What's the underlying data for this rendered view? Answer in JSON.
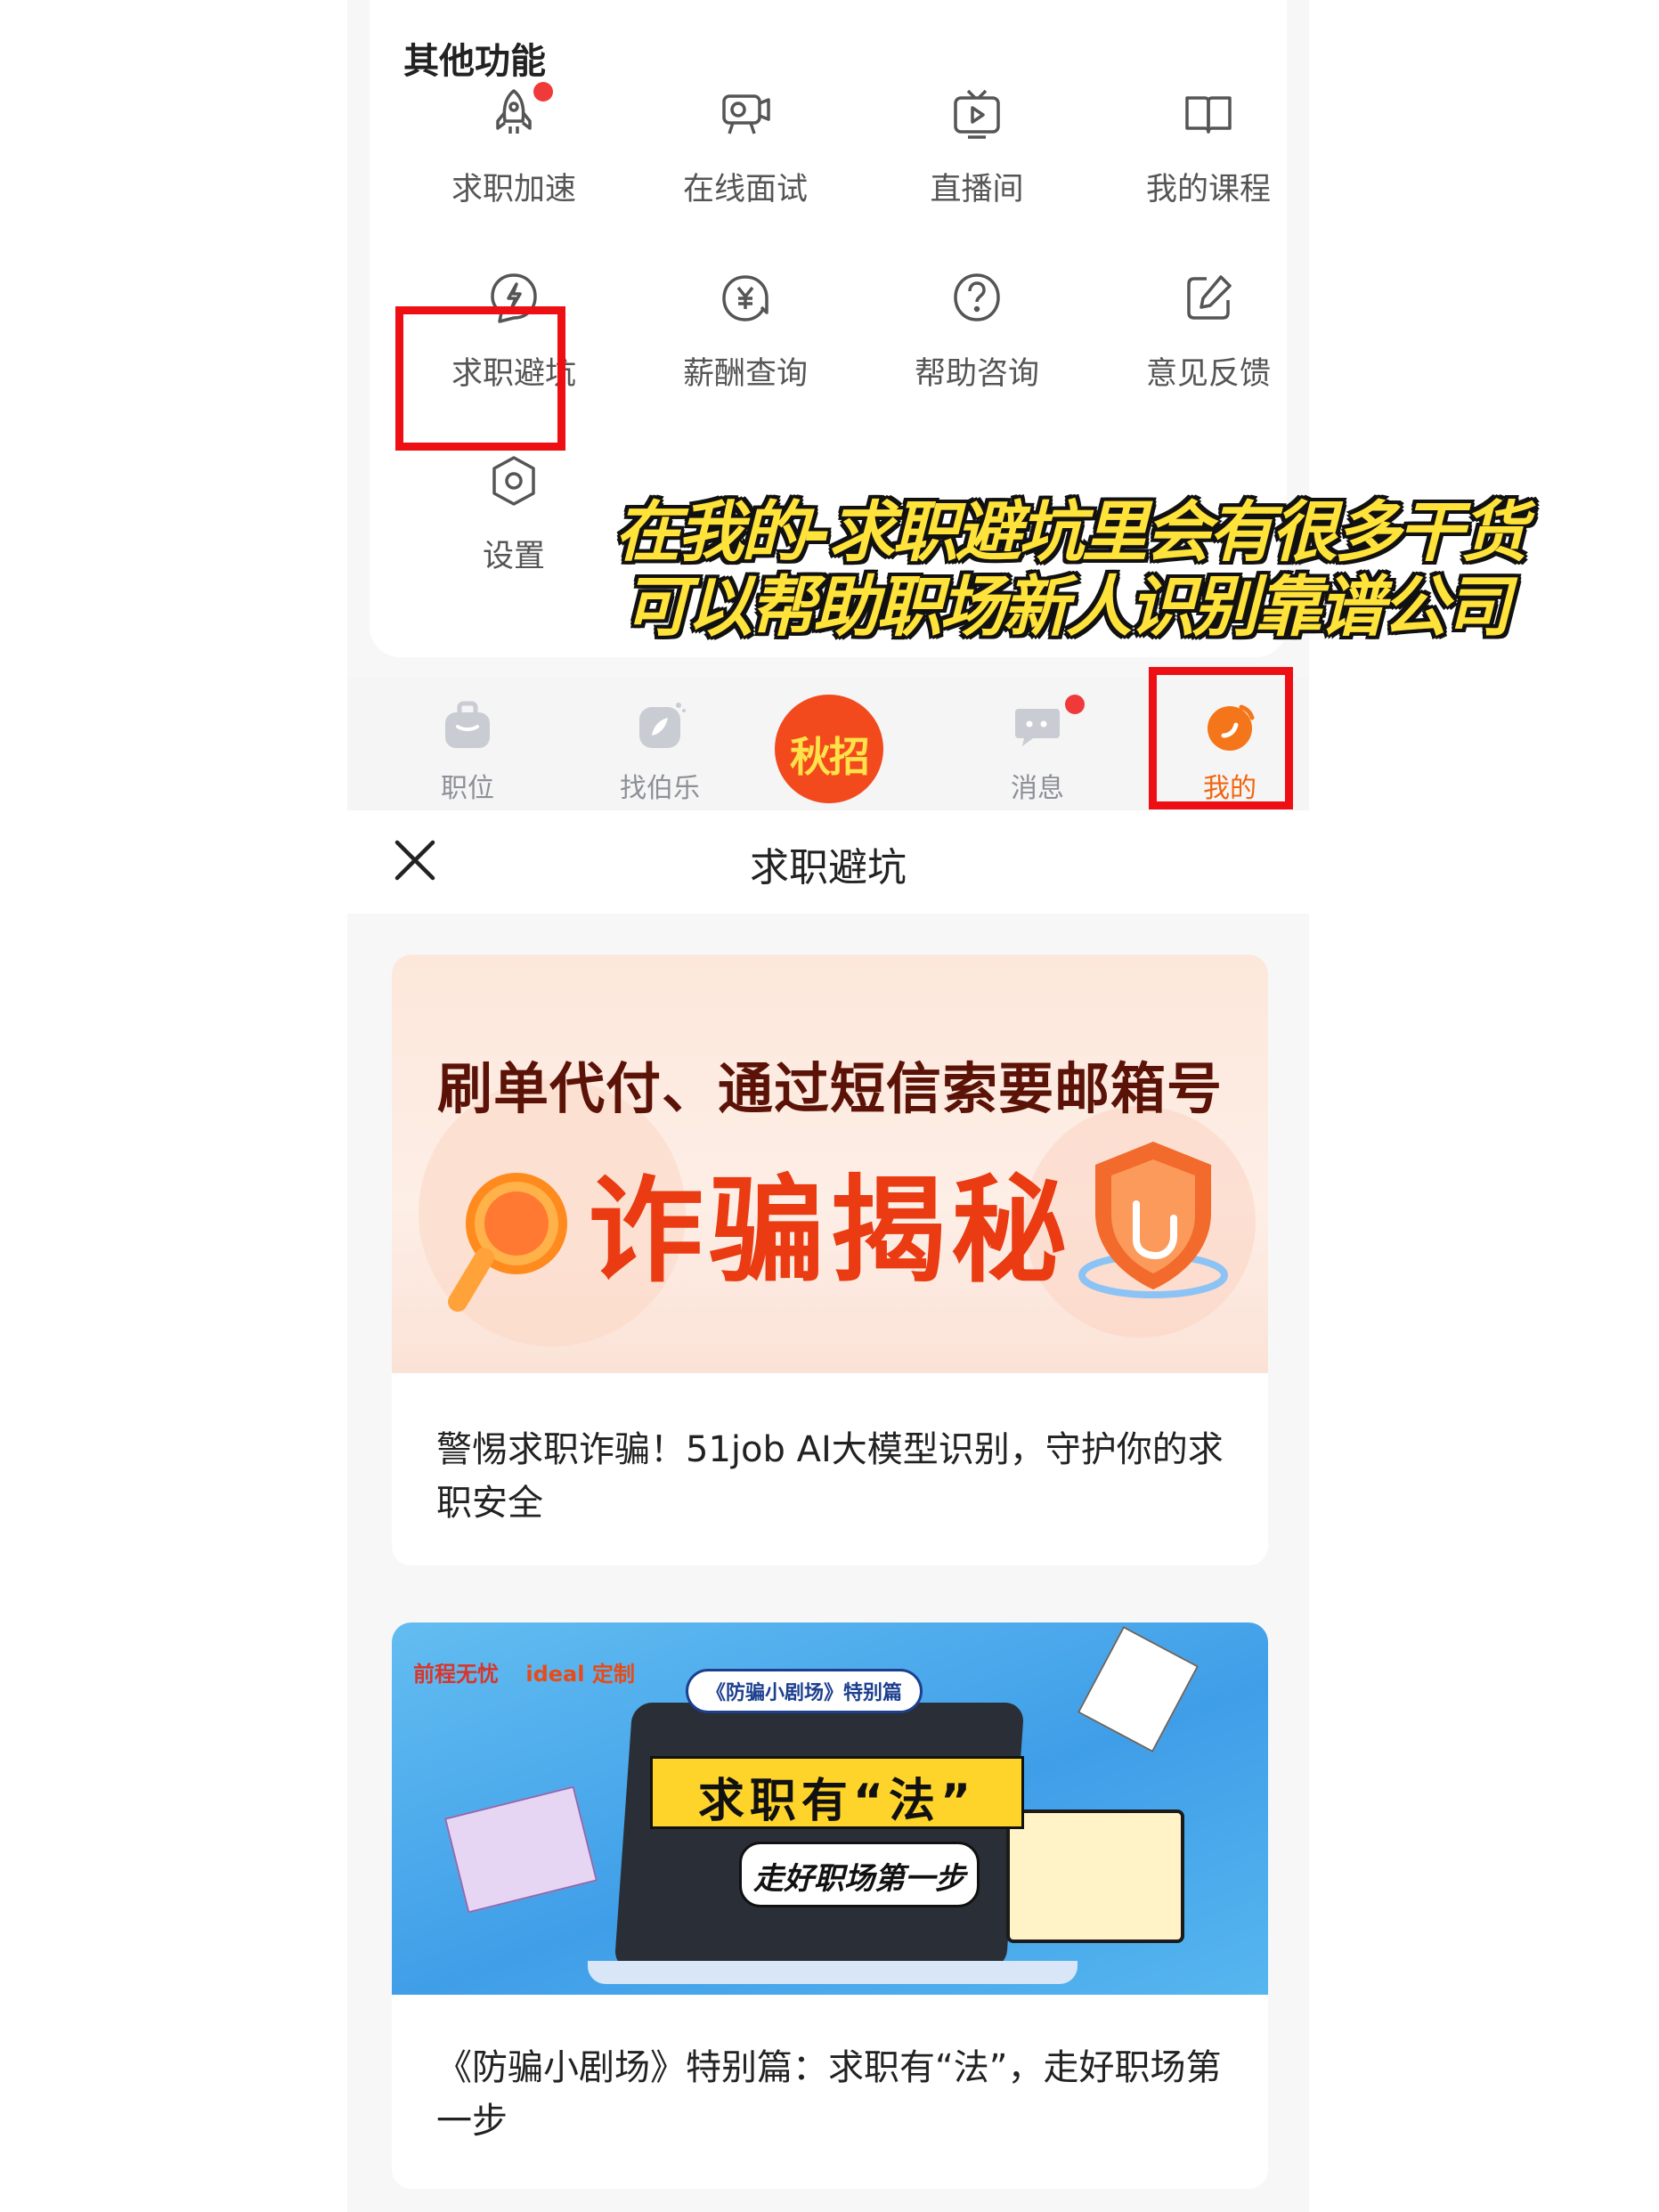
{
  "functions": {
    "title": "其他功能",
    "items": [
      {
        "label": "求职加速",
        "icon": "rocket-icon",
        "badge_dot": true
      },
      {
        "label": "在线面试",
        "icon": "video-camera-icon",
        "badge_dot": false
      },
      {
        "label": "直播间",
        "icon": "live-tv-icon",
        "badge_dot": false
      },
      {
        "label": "我的课程",
        "icon": "open-book-icon",
        "badge_dot": false
      },
      {
        "label": "求职避坑",
        "icon": "lightning-shield-icon",
        "badge_dot": false
      },
      {
        "label": "薪酬查询",
        "icon": "yen-coin-icon",
        "badge_dot": false
      },
      {
        "label": "帮助咨询",
        "icon": "help-question-icon",
        "badge_dot": false
      },
      {
        "label": "意见反馈",
        "icon": "edit-feedback-icon",
        "badge_dot": false
      },
      {
        "label": "设置",
        "icon": "settings-icon",
        "badge_dot": false
      }
    ]
  },
  "tabbar": {
    "items": [
      {
        "label": "职位",
        "icon": "briefcase-icon",
        "active": false
      },
      {
        "label": "找伯乐",
        "icon": "find-mentor-icon",
        "active": false
      },
      {
        "label": "秋招",
        "icon": "campus-recruit-icon",
        "active": false
      },
      {
        "label": "消息",
        "icon": "chat-bubble-icon",
        "active": false,
        "badge_dot": true
      },
      {
        "label": "我的",
        "icon": "profile-icon",
        "active": true
      }
    ],
    "active_color": "#f2650d"
  },
  "caption": {
    "line1": "在我的-求职避坑里会有很多干货",
    "line2": "可以帮助职场新人识别靠谱公司"
  },
  "page": {
    "title": "求职避坑",
    "close_icon": "close-icon"
  },
  "articles": [
    {
      "banner": {
        "subtitle": "刷单代付、通过短信索要邮箱号",
        "headline": "诈骗揭秘"
      },
      "title": "警惕求职诈骗！51job AI大模型识别，守护你的求职安全"
    },
    {
      "banner": {
        "brand": "前程无忧",
        "brand2": "ideal 定制",
        "series": "《防骗小剧场》特别篇",
        "headline": "求职有“法”",
        "subline": "走好职场第一步"
      },
      "title": "《防骗小剧场》特别篇：求职有“法”，走好职场第一步"
    }
  ],
  "colors": {
    "highlight": "#ee0f14",
    "accent": "#f2650d",
    "caption_text": "#ffe23a"
  }
}
